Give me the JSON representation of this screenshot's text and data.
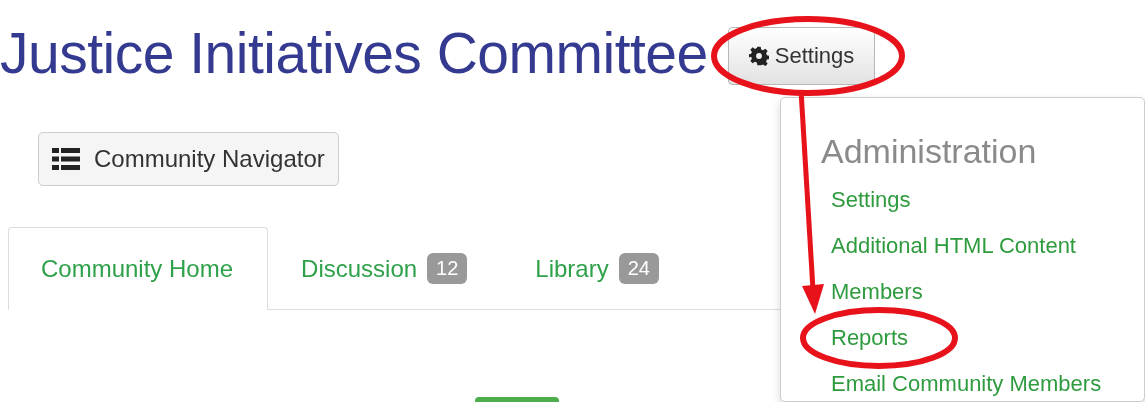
{
  "title": "Justice Initiatives Committee",
  "settings_button": {
    "label": "Settings",
    "highlighted": true
  },
  "navigator_button": {
    "label": "Community Navigator"
  },
  "tabs": [
    {
      "label": "Community Home",
      "selected": true
    },
    {
      "label": "Discussion",
      "count": "12",
      "selected": false
    },
    {
      "label": "Library",
      "count": "24",
      "selected": false
    }
  ],
  "settings_menu": {
    "heading": "Administration",
    "items": [
      {
        "label": "Settings",
        "highlighted": false
      },
      {
        "label": "Additional HTML Content",
        "highlighted": false
      },
      {
        "label": "Members",
        "highlighted": false
      },
      {
        "label": "Reports",
        "highlighted": true
      },
      {
        "label": "Email Community Members",
        "highlighted": false
      }
    ]
  }
}
